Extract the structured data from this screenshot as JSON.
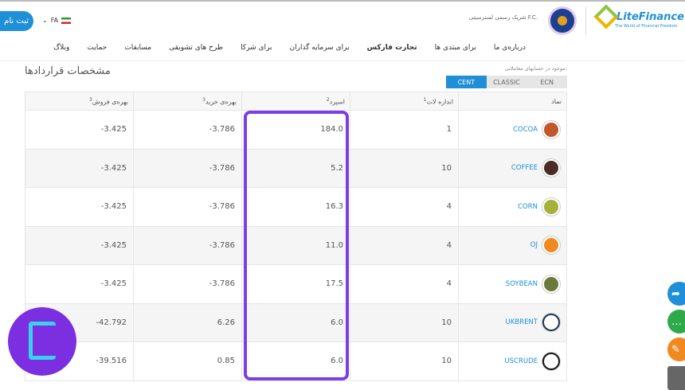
{
  "header": {
    "signup_label": "ثبت نام",
    "lang": "FA",
    "partner_text": "شریک رسمی لسترسیتی F.C.",
    "logo": "LiteFinance",
    "logo_tagline": "The World of Financial Freedom"
  },
  "nav": [
    "درباره‌ی ما",
    "برای مبتدی ها",
    "تجارت فارکس",
    "برای سرمایه گذاران",
    "برای شرکا",
    "طرح های تشویقی",
    "مسابقات",
    "حمایت",
    "وبلاگ"
  ],
  "nav_active": 2,
  "page": {
    "title": "مشخصات قراردادها",
    "available_label": "موجود در حسابهای معاملاتی:",
    "account_tabs": [
      "ECN",
      "CLASSIC",
      "CENT"
    ],
    "active_tab": "CENT"
  },
  "table": {
    "headers": [
      "نماد",
      "اندازه لات",
      "اسپرد",
      "بهره‌ی خرید",
      "بهره‌ی فروش"
    ],
    "header_sup": [
      "",
      "1",
      "2",
      "3",
      "3"
    ],
    "rows": [
      {
        "symbol": "COCOA",
        "lot": "1",
        "spread": "184.0",
        "buy": "-3.786",
        "sell": "-3.425",
        "color": "#c0582b"
      },
      {
        "symbol": "COFFEE",
        "lot": "10",
        "spread": "5.2",
        "buy": "-3.786",
        "sell": "-3.425",
        "color": "#4a2c22"
      },
      {
        "symbol": "CORN",
        "lot": "4",
        "spread": "16.3",
        "buy": "-3.786",
        "sell": "-3.425",
        "color": "#a6b13a"
      },
      {
        "symbol": "OJ",
        "lot": "4",
        "spread": "11.0",
        "buy": "-3.786",
        "sell": "-3.425",
        "color": "#f08a20"
      },
      {
        "symbol": "SOYBEAN",
        "lot": "4",
        "spread": "17.5",
        "buy": "-3.786",
        "sell": "-3.425",
        "color": "#6b7a3a"
      },
      {
        "symbol": "UKBRENT",
        "lot": "10",
        "spread": "6.0",
        "buy": "6.26",
        "sell": "-42.792",
        "color": "#1d3550"
      },
      {
        "symbol": "USCRUDE",
        "lot": "10",
        "spread": "6.0",
        "buy": "0.85",
        "sell": "-39.516",
        "color": "#111111"
      }
    ]
  },
  "colors": {
    "accent": "#1f8fd8",
    "highlight": "#7b3fe4"
  }
}
